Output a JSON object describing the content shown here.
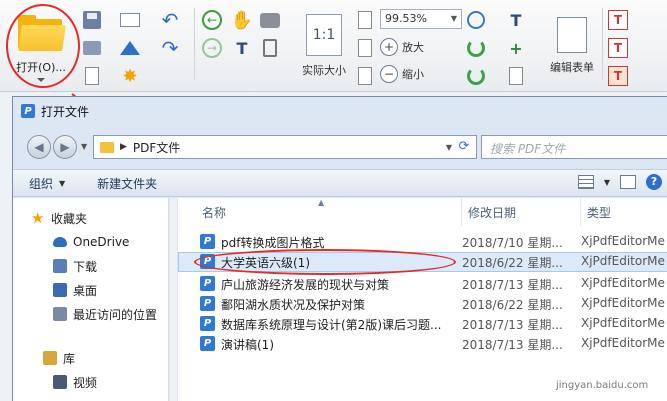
{
  "ribbon": {
    "open_label": "打开(O)...",
    "actual_size_label": "实际大小",
    "zoom_value": "99.53%",
    "zoom_in_label": "放大",
    "zoom_out_label": "缩小",
    "edit_form_label": "编辑表单",
    "actual_size_icon_text": "1:1"
  },
  "dialog": {
    "title": "打开文件",
    "address": {
      "folder": "PDF文件"
    },
    "search_placeholder": "搜索 PDF文件",
    "commands": {
      "organize": "组织",
      "new_folder": "新建文件夹"
    },
    "nav": [
      {
        "label": "收藏夹",
        "icon": "star-icon",
        "color": "#f2a400"
      },
      {
        "label": "OneDrive",
        "icon": "cloud-icon",
        "color": "#2f6ebf"
      },
      {
        "label": "下载",
        "icon": "download-folder-icon",
        "color": "#5b7fb5"
      },
      {
        "label": "桌面",
        "icon": "desktop-icon",
        "color": "#3a6ab0"
      },
      {
        "label": "最近访问的位置",
        "icon": "recent-places-icon",
        "color": "#7a8aa5"
      },
      {
        "label": "库",
        "icon": "library-icon",
        "color": "#d9a53a"
      },
      {
        "label": "视频",
        "icon": "video-icon",
        "color": "#4a5a74"
      }
    ],
    "columns": {
      "name": "名称",
      "date": "修改日期",
      "type": "类型"
    },
    "files": [
      {
        "name": "pdf转换成图片格式",
        "date": "2018/7/10 星期...",
        "type": "XjPdfEditorMe"
      },
      {
        "name": "大学英语六级(1)",
        "date": "2018/6/22 星期...",
        "type": "XjPdfEditorMe"
      },
      {
        "name": "庐山旅游经济发展的现状与对策",
        "date": "2018/7/13 星期...",
        "type": "XjPdfEditorMe"
      },
      {
        "name": "鄱阳湖水质状况及保护对策",
        "date": "2018/6/22 星期...",
        "type": "XjPdfEditorMe"
      },
      {
        "name": "数据库系统原理与设计(第2版)课后习题...",
        "date": "2018/7/13 星期...",
        "type": "XjPdfEditorMe"
      },
      {
        "name": "演讲稿(1)",
        "date": "2018/7/13 星期...",
        "type": "XjPdfEditorMe"
      }
    ]
  },
  "watermark": "jingyan.baidu.com",
  "colors": {
    "annotation": "#e52a2a",
    "accent": "#2f79d6"
  }
}
